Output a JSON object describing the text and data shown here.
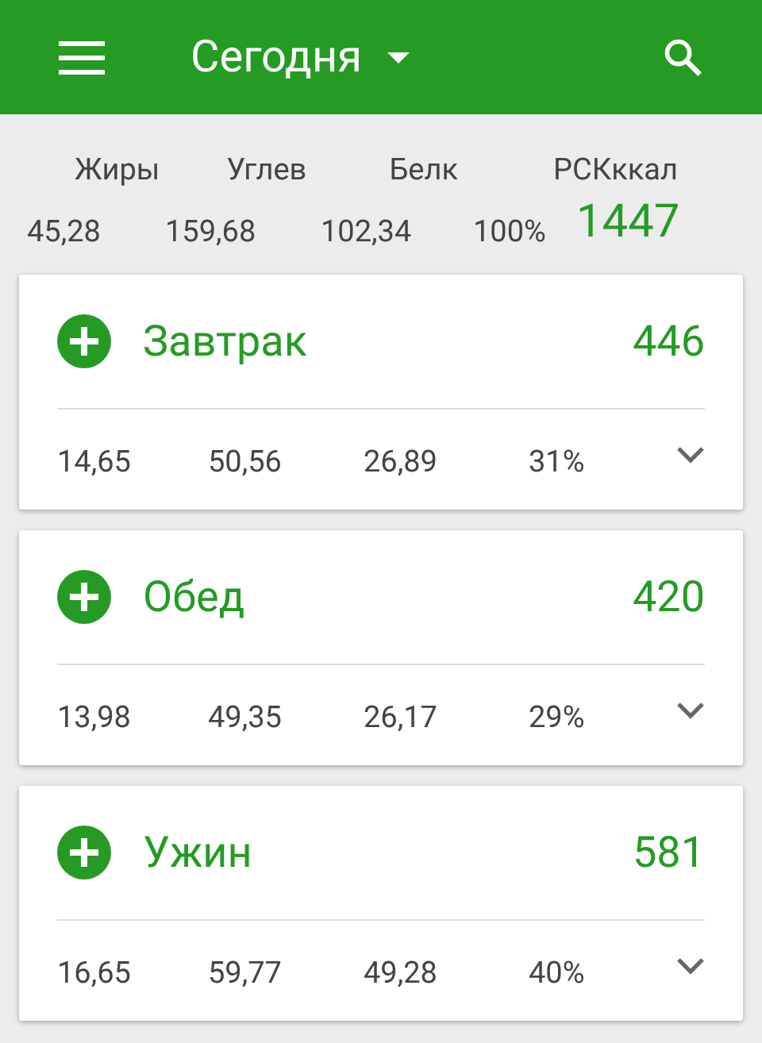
{
  "header": {
    "title": "Сегодня"
  },
  "summary": {
    "labels": [
      "Жиры",
      "Углев",
      "Белк",
      "РСК",
      "ккал"
    ],
    "values": [
      "45,28",
      "159,68",
      "102,34",
      "100%"
    ],
    "total": "1447"
  },
  "meals": [
    {
      "name": "Завтрак",
      "kcal": "446",
      "values": [
        "14,65",
        "50,56",
        "26,89",
        "31%"
      ],
      "expanded": false
    },
    {
      "name": "Обед",
      "kcal": "420",
      "values": [
        "13,98",
        "49,35",
        "26,17",
        "29%"
      ],
      "expanded": false
    },
    {
      "name": "Ужин",
      "kcal": "581",
      "values": [
        "16,65",
        "59,77",
        "49,28",
        "40%"
      ],
      "expanded": false
    }
  ]
}
